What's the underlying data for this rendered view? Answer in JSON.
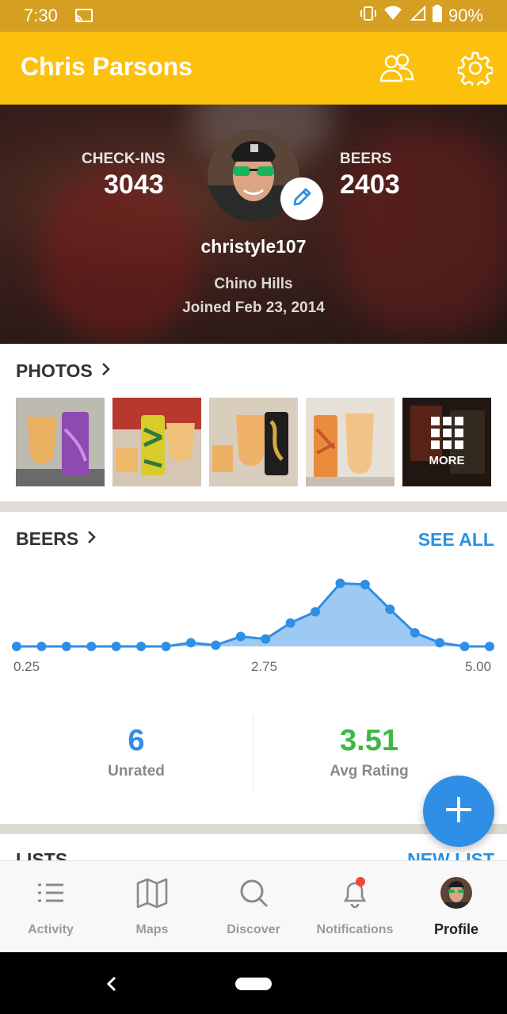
{
  "status": {
    "time": "7:30",
    "battery": "90%"
  },
  "app_bar": {
    "title": "Chris Parsons",
    "icons": [
      "friends-icon",
      "settings-icon"
    ]
  },
  "profile": {
    "checkins_label": "CHECK-INS",
    "checkins_value": "3043",
    "beers_label": "BEERS",
    "beers_value": "2403",
    "username": "christyle107",
    "location": "Chino Hills",
    "joined": "Joined Feb 23, 2014"
  },
  "photos": {
    "title": "PHOTOS",
    "more_label": "MORE",
    "count_shown": 4
  },
  "beers": {
    "title": "BEERS",
    "see_all": "SEE ALL",
    "unrated_value": "6",
    "unrated_label": "Unrated",
    "avg_value": "3.51",
    "avg_label": "Avg Rating"
  },
  "lists": {
    "title": "LISTS",
    "new_list": "NEW LIST"
  },
  "nav": {
    "items": [
      {
        "label": "Activity",
        "icon": "list-icon"
      },
      {
        "label": "Maps",
        "icon": "map-icon"
      },
      {
        "label": "Discover",
        "icon": "search-icon"
      },
      {
        "label": "Notifications",
        "icon": "bell-icon"
      },
      {
        "label": "Profile",
        "icon": "avatar"
      }
    ],
    "active": "Profile"
  },
  "colors": {
    "accent": "#fcc10d",
    "blue": "#2f8ee6",
    "green": "#3db847"
  },
  "chart_data": {
    "type": "area",
    "x": [
      0.25,
      0.5,
      0.75,
      1.0,
      1.25,
      1.5,
      1.75,
      2.0,
      2.25,
      2.5,
      2.75,
      3.0,
      3.25,
      3.5,
      3.75,
      4.0,
      4.25,
      4.5,
      4.75,
      5.0
    ],
    "values": [
      0,
      0,
      0,
      0,
      0,
      0,
      0,
      6,
      2,
      16,
      12,
      38,
      56,
      102,
      100,
      60,
      22,
      6,
      0,
      0
    ],
    "tick_labels": [
      "0.25",
      "2.75",
      "5.00"
    ],
    "ylim": [
      0,
      105
    ],
    "grid": false
  }
}
